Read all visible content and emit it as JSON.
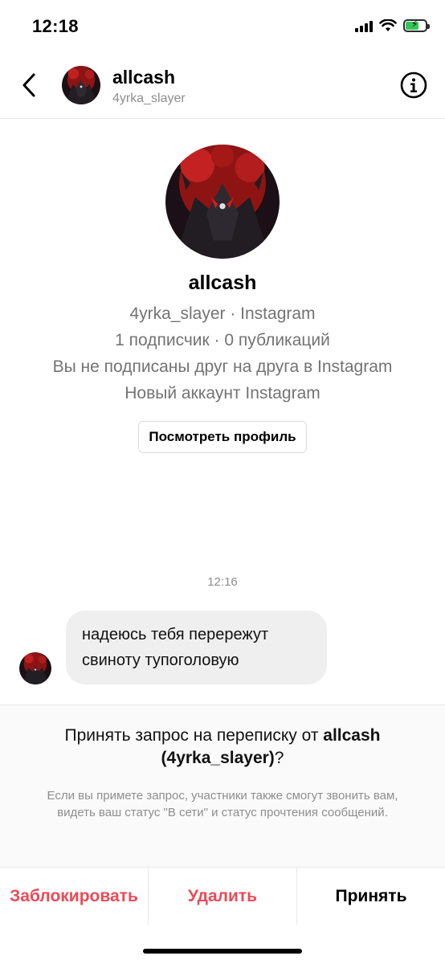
{
  "status_bar": {
    "time": "12:18",
    "icons": [
      "signal-icon",
      "wifi-icon",
      "battery-charging-icon"
    ],
    "battery_color": "#33c759"
  },
  "header": {
    "title": "allcash",
    "subtitle": "4yrka_slayer",
    "icons": [
      "chevron-left-icon",
      "info-icon"
    ]
  },
  "profile": {
    "name": "allcash",
    "line1": "4yrka_slayer · Instagram",
    "line2": "1 подписчик · 0 публикаций",
    "line3": "Вы не подписаны друг на друга в Instagram",
    "line4": "Новый аккаунт Instagram",
    "view_profile_label": "Посмотреть профиль"
  },
  "conversation": {
    "timestamp": "12:16",
    "messages": [
      {
        "text": "надеюсь тебя перережут свиноту тупоголовую"
      }
    ]
  },
  "request": {
    "question_prefix": "Принять запрос на переписку от ",
    "question_name": "allcash",
    "question_username": "(4yrka_slayer)",
    "question_suffix": "?",
    "note": "Если вы примете запрос, участники также смогут звонить вам, видеть ваш статус \"В сети\" и статус прочтения сообщений."
  },
  "actions": {
    "block_label": "Заблокировать",
    "delete_label": "Удалить",
    "accept_label": "Принять",
    "danger_color": "#ed4956"
  }
}
